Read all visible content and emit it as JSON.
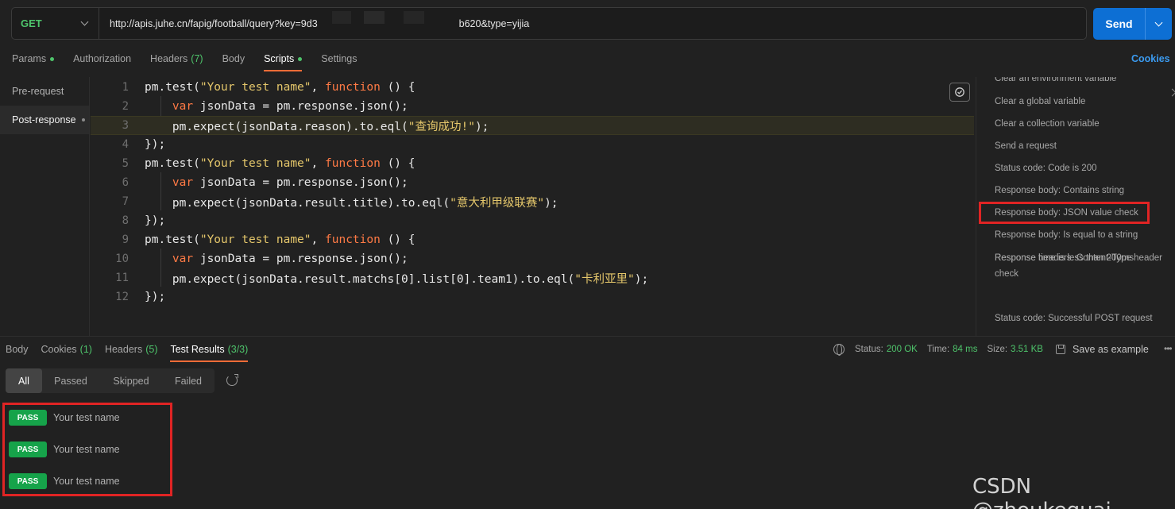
{
  "request": {
    "method": "GET",
    "url_visible": "http://apis.juhe.cn/fapig/football/query?key=9d3",
    "url_fragment_a": "b620&type=yijia",
    "send_label": "Send"
  },
  "request_tabs": [
    {
      "label": "Params",
      "dot": true
    },
    {
      "label": "Authorization"
    },
    {
      "label": "Headers",
      "count": "(7)"
    },
    {
      "label": "Body"
    },
    {
      "label": "Scripts",
      "dot": true,
      "active": true
    },
    {
      "label": "Settings"
    }
  ],
  "cookies_link": "Cookies",
  "script_nav": [
    {
      "label": "Pre-request"
    },
    {
      "label": "Post-response",
      "active": true
    }
  ],
  "code_lines": [
    {
      "n": "1",
      "tokens": [
        [
          "id",
          "pm.test("
        ],
        [
          "str",
          "\"Your test name\""
        ],
        [
          "id",
          ", "
        ],
        [
          "kw",
          "function"
        ],
        [
          "id",
          " () {"
        ]
      ]
    },
    {
      "n": "2",
      "tokens": [
        [
          "id",
          "    "
        ],
        [
          "kw",
          "var"
        ],
        [
          "id",
          " jsonData = pm.response.json();"
        ]
      ]
    },
    {
      "n": "3",
      "tokens": [
        [
          "id",
          "    pm.expect(jsonData.reason).to.eql("
        ],
        [
          "str",
          "\"查询成功!\""
        ],
        [
          "id",
          ");"
        ]
      ],
      "highlight": true
    },
    {
      "n": "4",
      "tokens": [
        [
          "id",
          "});"
        ]
      ]
    },
    {
      "n": "5",
      "tokens": [
        [
          "id",
          "pm.test("
        ],
        [
          "str",
          "\"Your test name\""
        ],
        [
          "id",
          ", "
        ],
        [
          "kw",
          "function"
        ],
        [
          "id",
          " () {"
        ]
      ]
    },
    {
      "n": "6",
      "tokens": [
        [
          "id",
          "    "
        ],
        [
          "kw",
          "var"
        ],
        [
          "id",
          " jsonData = pm.response.json();"
        ]
      ]
    },
    {
      "n": "7",
      "tokens": [
        [
          "id",
          "    pm.expect(jsonData.result.title).to.eql("
        ],
        [
          "str",
          "\"意大利甲级联赛\""
        ],
        [
          "id",
          ");"
        ]
      ]
    },
    {
      "n": "8",
      "tokens": [
        [
          "id",
          "});"
        ]
      ]
    },
    {
      "n": "9",
      "tokens": [
        [
          "id",
          "pm.test("
        ],
        [
          "str",
          "\"Your test name\""
        ],
        [
          "id",
          ", "
        ],
        [
          "kw",
          "function"
        ],
        [
          "id",
          " () {"
        ]
      ]
    },
    {
      "n": "10",
      "tokens": [
        [
          "id",
          "    "
        ],
        [
          "kw",
          "var"
        ],
        [
          "id",
          " jsonData = pm.response.json();"
        ]
      ]
    },
    {
      "n": "11",
      "tokens": [
        [
          "id",
          "    pm.expect(jsonData.result.matchs[0].list[0].team1).to.eql("
        ],
        [
          "str",
          "\"卡利亚里\""
        ],
        [
          "id",
          ");"
        ]
      ]
    },
    {
      "n": "12",
      "tokens": [
        [
          "id",
          "});"
        ]
      ]
    }
  ],
  "snippets": {
    "cut_top": "Clear an environment variable",
    "items": [
      "Clear a global variable",
      "Clear a collection variable",
      "Send a request",
      "Status code: Code is 200",
      "Response body: Contains string",
      "Response body: JSON value check",
      "Response body: Is equal to a string",
      "Response headers: Content-Type header check",
      "Response time is less than 200ms",
      "Status code: Successful POST request"
    ],
    "boxed_index": 5
  },
  "response_tabs": [
    {
      "label": "Body"
    },
    {
      "label": "Cookies",
      "count": "(1)"
    },
    {
      "label": "Headers",
      "count": "(5)"
    },
    {
      "label": "Test Results",
      "count": "(3/3)",
      "active": true
    }
  ],
  "status": {
    "status_label": "Status:",
    "status_value": "200 OK",
    "time_label": "Time:",
    "time_value": "84 ms",
    "size_label": "Size:",
    "size_value": "3.51 KB",
    "save_label": "Save as example",
    "more": "•••"
  },
  "filters": [
    {
      "label": "All",
      "active": true
    },
    {
      "label": "Passed"
    },
    {
      "label": "Skipped"
    },
    {
      "label": "Failed"
    }
  ],
  "results": [
    {
      "badge": "PASS",
      "name": "Your test name"
    },
    {
      "badge": "PASS",
      "name": "Your test name"
    },
    {
      "badge": "PASS",
      "name": "Your test name"
    }
  ],
  "watermark": "CSDN @zhoukeguai",
  "colors": {
    "accent_orange": "#ff6c37",
    "send_blue": "#0d6fd4",
    "pass_green": "#16a34a",
    "highlight_red": "#e02424"
  }
}
